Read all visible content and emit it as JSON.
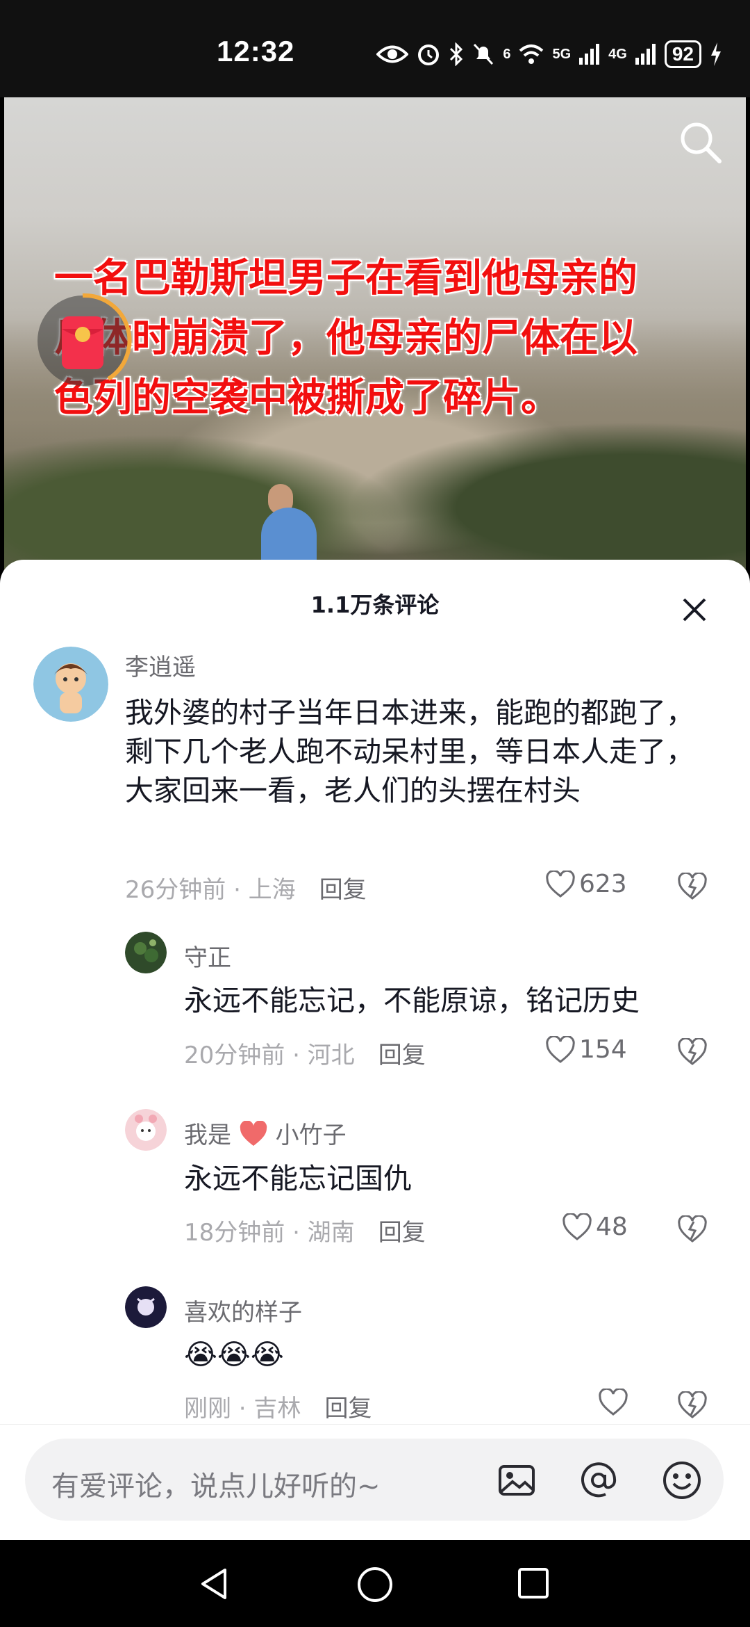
{
  "status_bar": {
    "time": "12:32",
    "battery": "92",
    "sig1": "6",
    "sig2": "5G",
    "sig3": "4G"
  },
  "video": {
    "overlay_lines": [
      "一名巴勒斯坦男子在看到他母亲的",
      "尸体时崩溃了，他母亲的尸体在以",
      "色列的空袭中被撕成了碎片。"
    ]
  },
  "sheet": {
    "title": "1.1万条评论",
    "comments": [
      {
        "user": "李逍遥",
        "text": "我外婆的村子当年日本进来，能跑的都跑了，剩下几个老人跑不动呆村里，等日本人走了，大家回来一看，老人们的头摆在村头",
        "meta": "26分钟前 · 上海",
        "reply": "回复",
        "likes": "623"
      },
      {
        "user": "守正",
        "text": "永远不能忘记，不能原谅，铭记历史",
        "meta": "20分钟前 · 河北",
        "reply": "回复",
        "likes": "154"
      },
      {
        "user_prefix": "我是",
        "user_suffix": "小竹子",
        "text": "永远不能忘记国仇",
        "meta": "18分钟前 · 湖南",
        "reply": "回复",
        "likes": "48"
      },
      {
        "user": "喜欢的样子",
        "text": "😭😭😭",
        "meta": "刚刚 · 吉林",
        "reply": "回复",
        "likes": ""
      }
    ]
  },
  "input": {
    "placeholder": "有爱评论，说点儿好听的~"
  },
  "colors": {
    "accent_red": "#f20f0f",
    "text_dark": "#161823",
    "text_gray": "#a9a9ad"
  }
}
